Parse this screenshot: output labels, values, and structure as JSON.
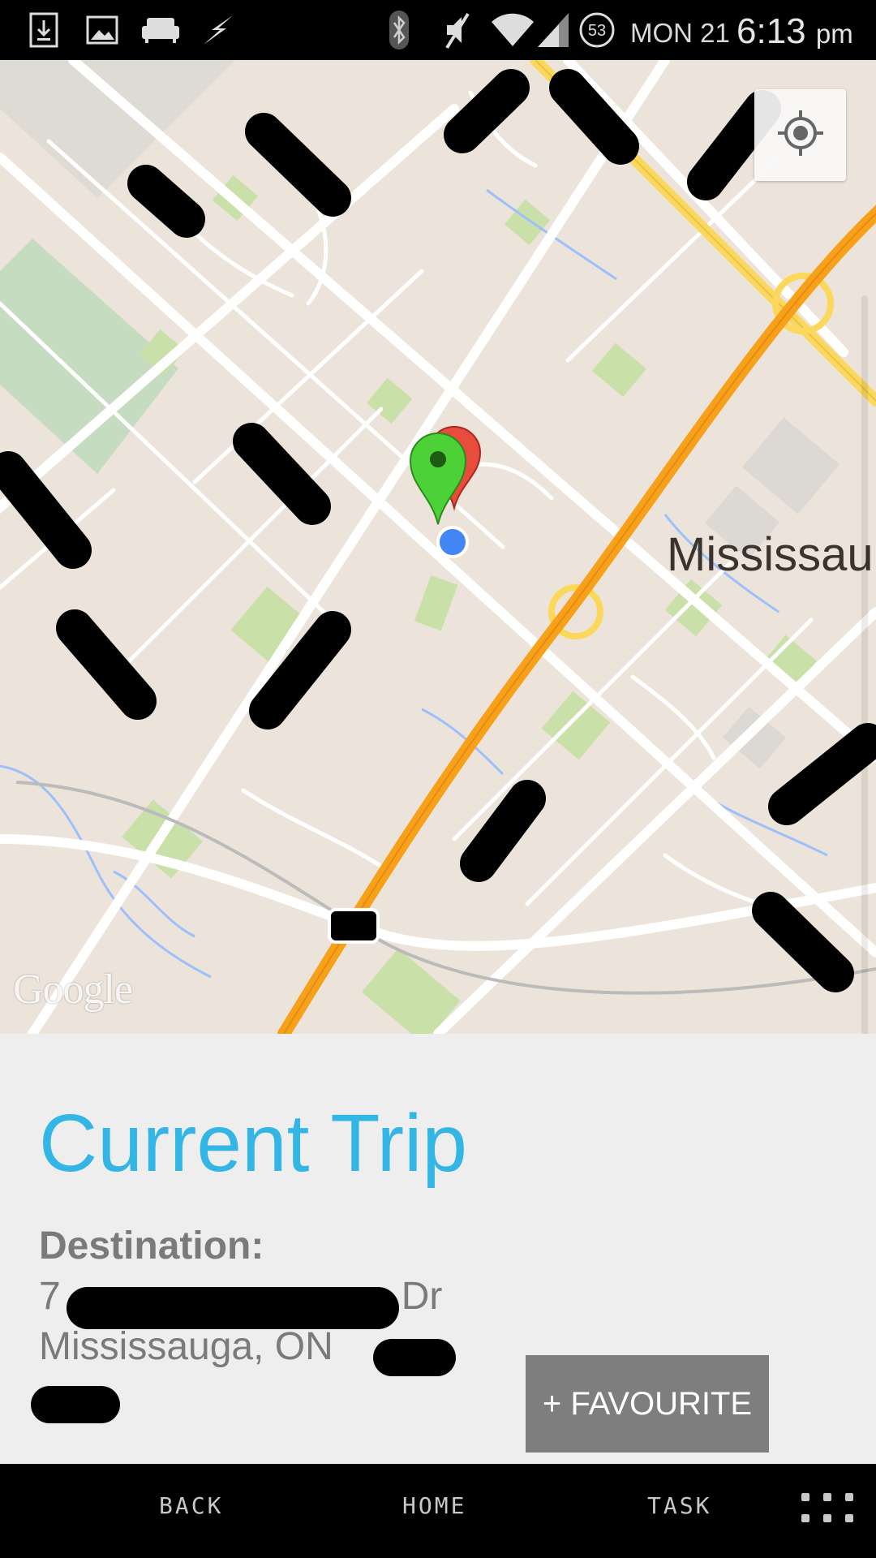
{
  "status_bar": {
    "date": "MON 21",
    "time": "6:13",
    "ampm": "pm",
    "badge_count": "53",
    "icons": [
      "download-icon",
      "image-icon",
      "sofa-icon",
      "flash-icon",
      "bluetooth-icon",
      "mute-icon",
      "wifi-icon",
      "signal-icon",
      "badge-icon"
    ]
  },
  "map": {
    "city_label": "Mississau",
    "logo": "Google",
    "colors": {
      "land": "#ece4da",
      "road": "#ffffff",
      "highway": "#f7a11b",
      "major_road": "#fbd85b",
      "park": "#cfe3b0",
      "water": "#9cc0f9",
      "marker_green": "#4cd137",
      "marker_red": "#e74c3c",
      "current_location": "#4285f4"
    }
  },
  "trip": {
    "title": "Current Trip",
    "destination_label": "Destination:",
    "address_line1_start": "7",
    "address_line1_end": "Dr",
    "address_line2": "Mississauga, ON",
    "favourite_button": "+ FAVOURITE"
  },
  "nav": {
    "back": "BACK",
    "home": "HOME",
    "task": "TASK"
  }
}
